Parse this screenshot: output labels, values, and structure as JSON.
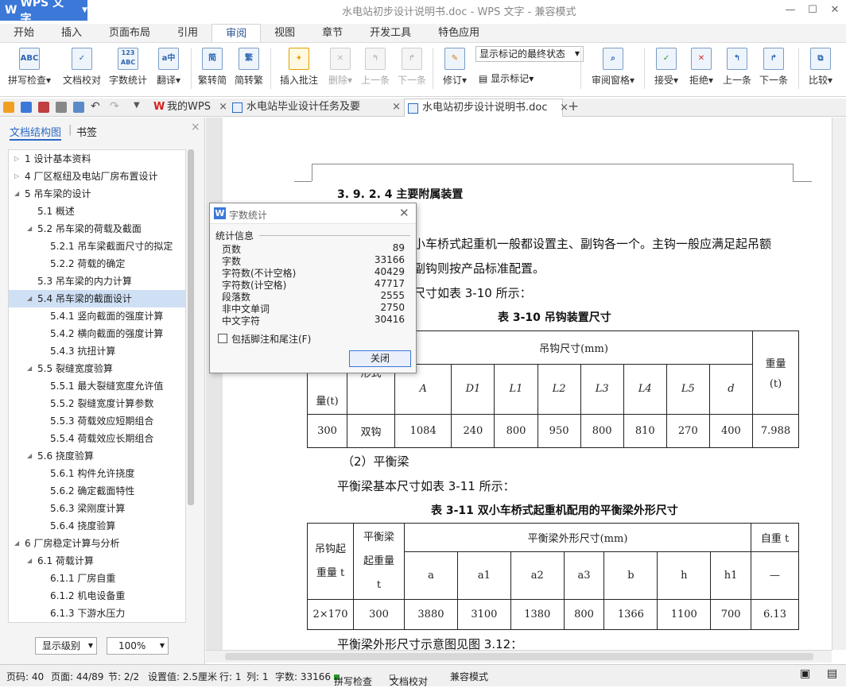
{
  "app": {
    "name": "WPS 文字",
    "window_title": "水电站初步设计说明书.doc - WPS 文字 - 兼容模式"
  },
  "menu_tabs": [
    "开始",
    "插入",
    "页面布局",
    "引用",
    "审阅",
    "视图",
    "章节",
    "开发工具",
    "特色应用"
  ],
  "active_menu_tab": "审阅",
  "ribbon": {
    "spell_check": "拼写检查",
    "doc_proof": "文档校对",
    "word_count": "字数统计",
    "translate": "翻译",
    "trad_to_simp": "繁转简",
    "simp_to_trad": "简转繁",
    "insert_comment": "插入批注",
    "delete": "删除",
    "prev": "上一条",
    "next": "下一条",
    "revise": "修订",
    "show_markup": "显示标记",
    "markup_state": "显示标记的最终状态",
    "review_pane": "审阅窗格",
    "accept": "接受",
    "reject": "拒绝",
    "prev2": "上一条",
    "next2": "下一条",
    "compare": "比较",
    "icons": {
      "spell_check": "ABC",
      "word_count": "123 ABC",
      "translate": "a中",
      "trad_to_simp": "简",
      "simp_to_trad": "繁"
    }
  },
  "doc_tabs": [
    {
      "label": "我的WPS"
    },
    {
      "label": "水电站毕业设计任务及要求.doc"
    },
    {
      "label": "水电站初步设计说明书.doc"
    }
  ],
  "left_panel": {
    "tab_structure": "文档结构图",
    "tab_bookmarks": "书签",
    "tree": [
      {
        "label": "1  设计基本资料",
        "indent": 0,
        "twisty": "▷"
      },
      {
        "label": "4  厂区枢纽及电站厂房布置设计",
        "indent": 0,
        "twisty": "▷"
      },
      {
        "label": "5 吊车梁的设计",
        "indent": 0,
        "twisty": "◢"
      },
      {
        "label": "5.1  概述",
        "indent": 1,
        "twisty": ""
      },
      {
        "label": "5.2  吊车梁的荷载及截面",
        "indent": 1,
        "twisty": "◢"
      },
      {
        "label": "5.2.1 吊车梁截面尺寸的拟定",
        "indent": 2,
        "twisty": ""
      },
      {
        "label": "5.2.2 荷载的确定",
        "indent": 2,
        "twisty": ""
      },
      {
        "label": "5.3 吊车梁的内力计算",
        "indent": 1,
        "twisty": ""
      },
      {
        "label": "5.4  吊车梁的截面设计",
        "indent": 1,
        "twisty": "◢",
        "selected": true
      },
      {
        "label": "5.4.1  竖向截面的强度计算",
        "indent": 2,
        "twisty": ""
      },
      {
        "label": "5.4.2  横向截面的强度计算",
        "indent": 2,
        "twisty": ""
      },
      {
        "label": "5.4.3  抗扭计算",
        "indent": 2,
        "twisty": ""
      },
      {
        "label": "5.5  裂缝宽度验算",
        "indent": 1,
        "twisty": "◢"
      },
      {
        "label": "5.5.1  最大裂缝宽度允许值",
        "indent": 2,
        "twisty": ""
      },
      {
        "label": "5.5.2  裂缝宽度计算参数",
        "indent": 2,
        "twisty": ""
      },
      {
        "label": "5.5.3    荷载效应短期组合",
        "indent": 2,
        "twisty": ""
      },
      {
        "label": "5.5.4  荷载效应长期组合",
        "indent": 2,
        "twisty": ""
      },
      {
        "label": "5.6    挠度验算",
        "indent": 1,
        "twisty": "◢"
      },
      {
        "label": "5.6.1    构件允许挠度",
        "indent": 2,
        "twisty": ""
      },
      {
        "label": "5.6.2    确定截面特性",
        "indent": 2,
        "twisty": ""
      },
      {
        "label": "5.6.3    梁刚度计算",
        "indent": 2,
        "twisty": ""
      },
      {
        "label": "5.6.4    挠度验算",
        "indent": 2,
        "twisty": ""
      },
      {
        "label": "6  厂房稳定计算与分析",
        "indent": 0,
        "twisty": "◢"
      },
      {
        "label": "6.1  荷载计算",
        "indent": 1,
        "twisty": "◢"
      },
      {
        "label": "6.1.1  厂房自重",
        "indent": 2,
        "twisty": ""
      },
      {
        "label": "6.1.2    机电设备重",
        "indent": 2,
        "twisty": ""
      },
      {
        "label": "6.1.3  下游水压力",
        "indent": 2,
        "twisty": ""
      }
    ],
    "level_select": "显示级别",
    "zoom_select": "100%"
  },
  "document": {
    "heading": "3. 9. 2. 4  主要附属装置",
    "para1a": "小车桥式起重机一般都设置主、副钩各一个。主钩一般应满足起吊额",
    "para1b": "副钩则按产品标准配置。",
    "para1c": "尺寸如表 3-10 所示：",
    "table1_title": "表 3-10 吊钩装置尺寸",
    "table1": {
      "group_header": "吊钩尺寸(mm)",
      "weight_header": "重量",
      "weight_unit": "(t)",
      "left_header": "量(t)",
      "form_header": "形式",
      "cols": [
        "A",
        "D1",
        "L1",
        "L2",
        "L3",
        "L4",
        "L5",
        "d"
      ],
      "row": [
        "300",
        "双钩",
        "1084",
        "240",
        "800",
        "950",
        "800",
        "810",
        "270",
        "400",
        "7.988"
      ]
    },
    "sub2": "（2）平衡梁",
    "para2": "平衡梁基本尺寸如表 3-11 所示：",
    "table2_title": "表 3-11 双小车桥式起重机配用的平衡梁外形尺寸",
    "table2": {
      "c1a": "吊钩起",
      "c1b": "重量  t",
      "c2a": "平衡梁",
      "c2b": "起重量",
      "c2c": "t",
      "group_header": "平衡梁外形尺寸(mm)",
      "self_weight": "自重  t",
      "cols": [
        "a",
        "a1",
        "a2",
        "a3",
        "b",
        "h",
        "h1",
        "—"
      ],
      "row": [
        "2×170",
        "300",
        "3880",
        "3100",
        "1380",
        "800",
        "1366",
        "1100",
        "700",
        "6.13"
      ]
    },
    "para3": "平衡梁外形尺寸示意图见图 3.12："
  },
  "dialog": {
    "title": "字数统计",
    "section": "统计信息",
    "rows": [
      {
        "k": "页数",
        "v": "89"
      },
      {
        "k": "字数",
        "v": "33166"
      },
      {
        "k": "字符数(不计空格)",
        "v": "40429"
      },
      {
        "k": "字符数(计空格)",
        "v": "47717"
      },
      {
        "k": "段落数",
        "v": "2555"
      },
      {
        "k": "非中文单词",
        "v": "2750"
      },
      {
        "k": "中文字符",
        "v": "30416"
      }
    ],
    "checkbox": "包括脚注和尾注(F)",
    "close": "关闭"
  },
  "status": {
    "page_code": "页码: 40",
    "page": "页面: 44/89",
    "section": "节: 2/2",
    "setting": "设置值: 2.5厘米",
    "row": "行: 1",
    "col": "列: 1",
    "words": "字数: 33166",
    "spell": "拼写检查",
    "proof": "文档校对",
    "compat": "兼容模式"
  },
  "colors": {
    "accent": "#3b78d8",
    "selected": "#cfe0f5"
  }
}
